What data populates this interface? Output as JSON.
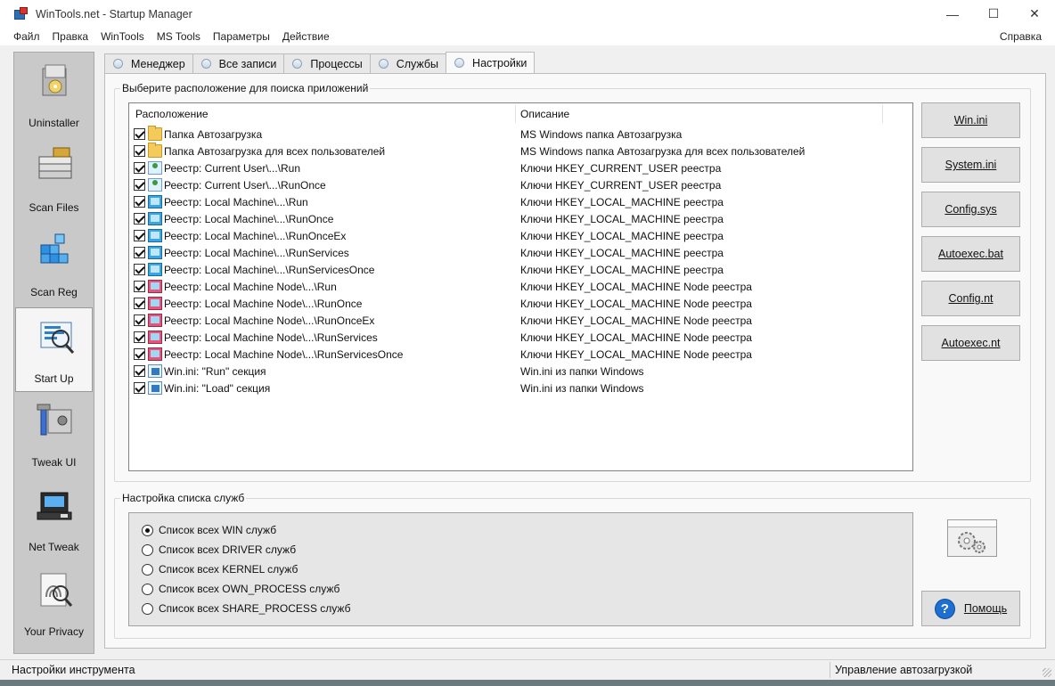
{
  "window": {
    "title": "WinTools.net - Startup Manager",
    "minimize": "—",
    "maximize": "☐",
    "close": "✕"
  },
  "menu": {
    "items": [
      "Файл",
      "Правка",
      "WinTools",
      "MS Tools",
      "Параметры",
      "Действие"
    ],
    "help": "Справка"
  },
  "sidebar": {
    "items": [
      {
        "label": "Uninstaller",
        "icon": "uninstaller-icon"
      },
      {
        "label": "Scan Files",
        "icon": "scan-files-icon"
      },
      {
        "label": "Scan Reg",
        "icon": "scan-reg-icon"
      },
      {
        "label": "Start Up",
        "icon": "startup-icon",
        "active": true
      },
      {
        "label": "Tweak UI",
        "icon": "tweak-ui-icon"
      },
      {
        "label": "Net Tweak",
        "icon": "net-tweak-icon"
      },
      {
        "label": "Your Privacy",
        "icon": "privacy-icon"
      }
    ]
  },
  "tabs": [
    {
      "label": "Менеджер"
    },
    {
      "label": "Все записи"
    },
    {
      "label": "Процессы"
    },
    {
      "label": "Службы"
    },
    {
      "label": "Настройки",
      "active": true
    }
  ],
  "locations_group": {
    "title": "Выберите расположение для поиска приложений",
    "columns": [
      "Расположение",
      "Описание"
    ],
    "rows": [
      {
        "location": "Папка Автозагрузка",
        "description": "MS Windows папка Автозагрузка",
        "icon": "folder-icon",
        "checked": true
      },
      {
        "location": "Папка Автозагрузка для всех пользователей",
        "description": "MS Windows папка Автозагрузка для всех пользователей",
        "icon": "folder-icon",
        "checked": true
      },
      {
        "location": "Реестр: Current User\\...\\Run",
        "description": "Ключи HKEY_CURRENT_USER реестра",
        "icon": "user-registry-icon",
        "checked": true
      },
      {
        "location": "Реестр: Current User\\...\\RunOnce",
        "description": "Ключи HKEY_CURRENT_USER реестра",
        "icon": "user-registry-icon",
        "checked": true
      },
      {
        "location": "Реестр: Local Machine\\...\\Run",
        "description": "Ключи HKEY_LOCAL_MACHINE реестра",
        "icon": "machine-registry-icon",
        "checked": true
      },
      {
        "location": "Реестр: Local Machine\\...\\RunOnce",
        "description": "Ключи HKEY_LOCAL_MACHINE реестра",
        "icon": "machine-registry-icon",
        "checked": true
      },
      {
        "location": "Реестр: Local Machine\\...\\RunOnceEx",
        "description": "Ключи HKEY_LOCAL_MACHINE реестра",
        "icon": "machine-registry-icon",
        "checked": true
      },
      {
        "location": "Реестр: Local Machine\\...\\RunServices",
        "description": "Ключи HKEY_LOCAL_MACHINE реестра",
        "icon": "machine-registry-icon",
        "checked": true
      },
      {
        "location": "Реестр: Local Machine\\...\\RunServicesOnce",
        "description": "Ключи HKEY_LOCAL_MACHINE реестра",
        "icon": "machine-registry-icon",
        "checked": true
      },
      {
        "location": "Реестр: Local Machine Node\\...\\Run",
        "description": "Ключи HKEY_LOCAL_MACHINE Node реестра",
        "icon": "node-registry-icon",
        "checked": true
      },
      {
        "location": "Реестр: Local Machine Node\\...\\RunOnce",
        "description": "Ключи HKEY_LOCAL_MACHINE Node реестра",
        "icon": "node-registry-icon",
        "checked": true
      },
      {
        "location": "Реестр: Local Machine Node\\...\\RunOnceEx",
        "description": "Ключи HKEY_LOCAL_MACHINE Node реестра",
        "icon": "node-registry-icon",
        "checked": true
      },
      {
        "location": "Реестр: Local Machine Node\\...\\RunServices",
        "description": "Ключи HKEY_LOCAL_MACHINE Node реестра",
        "icon": "node-registry-icon",
        "checked": true
      },
      {
        "location": "Реестр: Local Machine Node\\...\\RunServicesOnce",
        "description": "Ключи HKEY_LOCAL_MACHINE Node реестра",
        "icon": "node-registry-icon",
        "checked": true
      },
      {
        "location": "Win.ini: \"Run\" секция",
        "description": "Win.ini из папки Windows",
        "icon": "winini-icon",
        "checked": true
      },
      {
        "location": "Win.ini: \"Load\" секция",
        "description": "Win.ini из папки Windows",
        "icon": "winini-icon",
        "checked": true
      }
    ]
  },
  "file_buttons": [
    {
      "label": "Win.ini"
    },
    {
      "label": "System.ini"
    },
    {
      "label": "Config.sys"
    },
    {
      "label": "Autoexec.bat"
    },
    {
      "label": "Config.nt"
    },
    {
      "label": "Autoexec.nt"
    }
  ],
  "services_group": {
    "title": "Настройка списка служб",
    "options": [
      {
        "label": "Список всех WIN служб",
        "selected": true
      },
      {
        "label": "Список всех DRIVER служб",
        "selected": false
      },
      {
        "label": "Список всех KERNEL служб",
        "selected": false
      },
      {
        "label": "Список всех OWN_PROCESS служб",
        "selected": false
      },
      {
        "label": "Список всех SHARE_PROCESS служб",
        "selected": false
      }
    ]
  },
  "help_button": {
    "label": "Помощь",
    "icon_glyph": "?"
  },
  "statusbar": {
    "left": "Настройки инструмента",
    "right": "Управление автозагрузкой"
  }
}
